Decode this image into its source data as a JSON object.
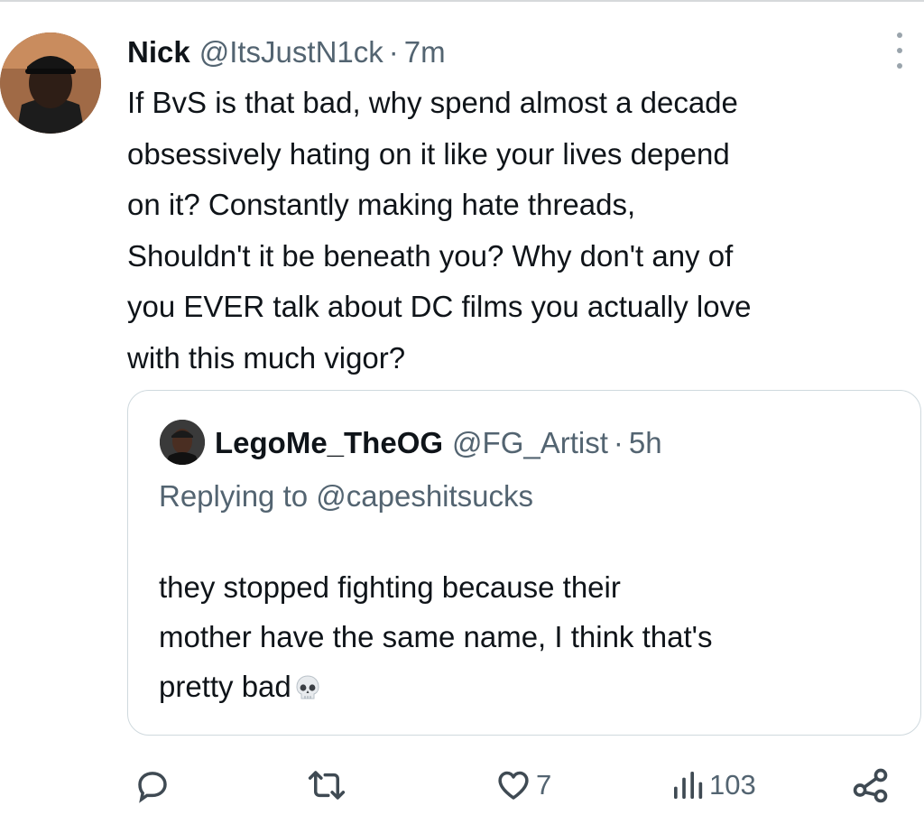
{
  "tweet": {
    "author_name": "Nick",
    "author_handle": "@ItsJustN1ck",
    "separator": "·",
    "time": "7m",
    "text_lines": [
      "If BvS is that bad, why spend almost a decade",
      "obsessively hating on it like your lives depend",
      "on it? Constantly making hate threads,",
      "Shouldn't it be beneath you? Why don't any of",
      "you EVER talk about DC films you actually love",
      "with this much vigor?"
    ]
  },
  "quote": {
    "author_name": "LegoMe_TheOG",
    "author_handle": "@FG_Artist",
    "separator": "·",
    "time": "5h",
    "replying_to": "Replying to @capeshitsucks",
    "text_lines": [
      "they stopped fighting because their",
      "mother have the same name, I think that's",
      "pretty bad"
    ],
    "emoji_icon": "skull-icon"
  },
  "actions": {
    "reply_icon": "reply-icon",
    "retweet_icon": "retweet-icon",
    "like_icon": "heart-icon",
    "like_count": "7",
    "views_icon": "views-icon",
    "views_count": "103",
    "share_icon": "share-icon"
  },
  "colors": {
    "text": "#0f1419",
    "secondary": "#536471",
    "border": "#cfd9de"
  }
}
